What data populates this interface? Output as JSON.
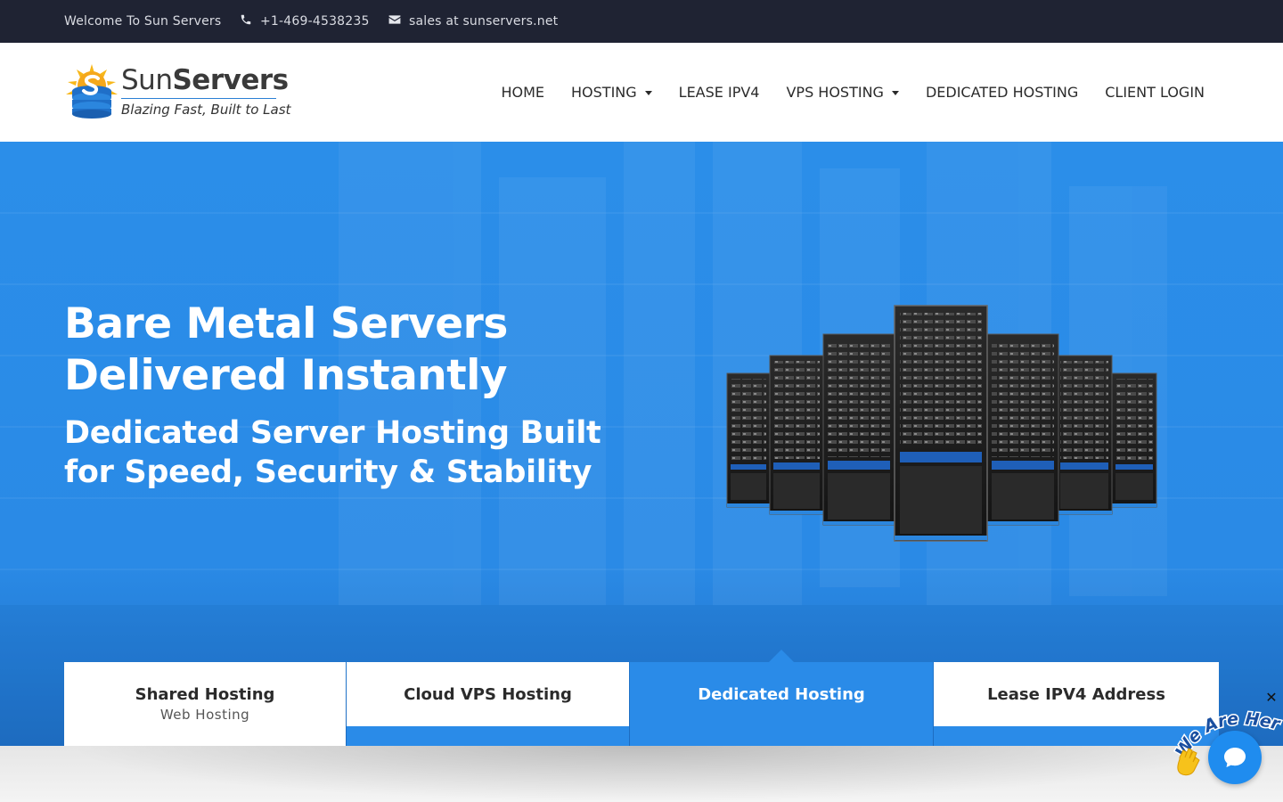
{
  "topbar": {
    "welcome": "Welcome To Sun Servers",
    "phone": "+1-469-4538235",
    "email": "sales at sunservers.net",
    "phone_icon": "phone-icon",
    "email_icon": "envelope-icon"
  },
  "logo": {
    "name_light": "Sun",
    "name_bold": "Servers",
    "tagline": "Blazing Fast, Built to Last"
  },
  "nav": {
    "home": "HOME",
    "hosting": "HOSTING",
    "lease_ipv4": "LEASE IPV4",
    "vps_hosting": "VPS HOSTING",
    "dedicated_hosting": "DEDICATED HOSTING",
    "client_login": "CLIENT LOGIN"
  },
  "hero": {
    "headline_line1": "Bare Metal Servers",
    "headline_line2": "Delivered Instantly",
    "subheadline_line1": "Dedicated Server Hosting Built",
    "subheadline_line2": "for Speed, Security & Stability"
  },
  "tabs": [
    {
      "title": "Shared Hosting",
      "subtitle": "Web Hosting"
    },
    {
      "title": "Cloud VPS Hosting",
      "subtitle": ""
    },
    {
      "title": "Dedicated Hosting",
      "subtitle": ""
    },
    {
      "title": "Lease IPV4 Address",
      "subtitle": ""
    }
  ],
  "active_tab": "Dedicated Hosting",
  "chat": {
    "badge_text": "We Are Here!",
    "close_symbol": "✕",
    "chat_icon": "chat-bubble-icon"
  },
  "colors": {
    "topbar_bg": "#1f2333",
    "hero_blue": "#2a8be8",
    "accent_blue": "#1f8cef",
    "badge_dark_blue": "#1a4fa0"
  }
}
